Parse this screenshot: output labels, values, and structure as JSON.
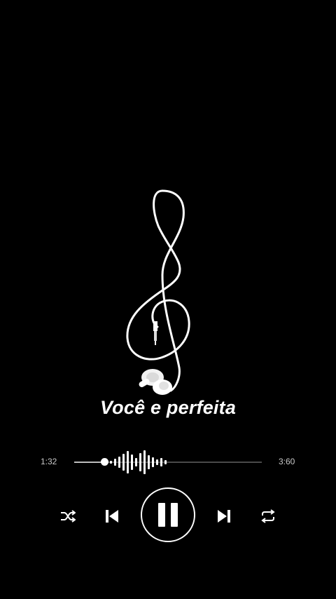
{
  "song": {
    "title": "Você e perfeita"
  },
  "album_art": {
    "icon": "treble-clef-earphones-icon"
  },
  "progress": {
    "elapsed": "1:32",
    "total": "3:60",
    "fraction": 0.16
  },
  "controls": {
    "shuffle_icon": "shuffle-icon",
    "previous_icon": "skip-previous-icon",
    "play_pause_icon": "pause-icon",
    "next_icon": "skip-next-icon",
    "repeat_icon": "repeat-icon",
    "state": "playing"
  },
  "colors": {
    "background": "#000000",
    "foreground": "#ffffff",
    "track": "#4a4a4a"
  }
}
